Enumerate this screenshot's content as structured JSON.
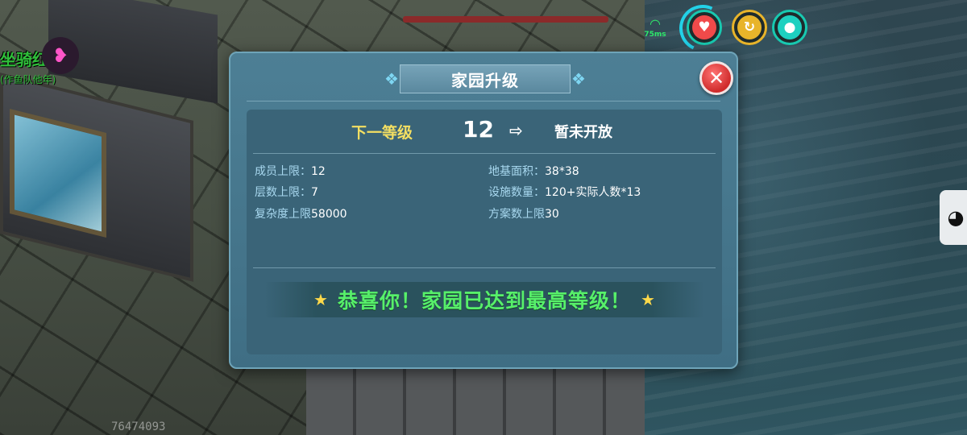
{
  "hud": {
    "ping": "75ms",
    "player_name": "坐骑红蝶",
    "player_subtitle": "(作鱼队他年)",
    "uid": "76474093",
    "icons": [
      "wifi-signal-icon",
      "heart-icon",
      "stamina-icon",
      "water-drop-icon",
      "qq-penguin-icon"
    ]
  },
  "dialog": {
    "title": "家园升级",
    "next_level_label": "下一等级",
    "current_level": "12",
    "next_level_value": "暂未开放",
    "stats": {
      "members_label": "成员上限：",
      "members_value": "12",
      "floors_label": "层数上限：",
      "floors_value": "7",
      "complexity_label": "复杂度上限",
      "complexity_value": "58000",
      "foundation_label": "地基面积：",
      "foundation_value": "38*38",
      "facilities_label": "设施数量：",
      "facilities_value": "120+实际人数*13",
      "plans_label": "方案数上限",
      "plans_value": "30"
    },
    "congrats_text": "恭喜你！家园已达到最高等级！"
  },
  "colors": {
    "dialog_bg": "#4a7c92",
    "panel_bg": "#3a6478",
    "next_level_label": "#f4df62",
    "congrats_text": "#57f06a",
    "close_button": "#e03a3a",
    "stat_label": "#a8d8ef"
  }
}
